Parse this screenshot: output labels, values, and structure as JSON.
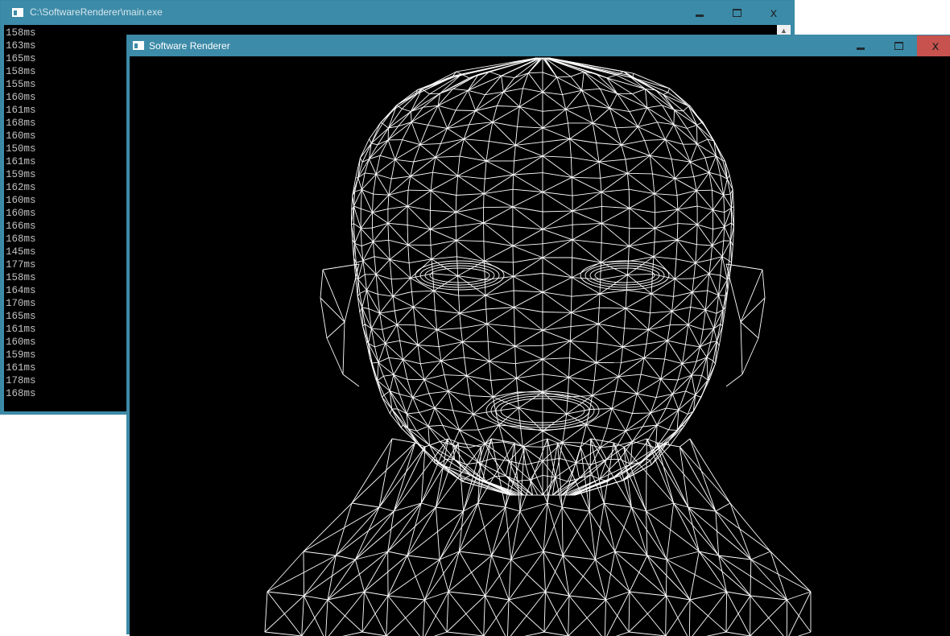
{
  "console": {
    "title": "C:\\SoftwareRenderer\\main.exe",
    "lines": [
      "158ms",
      "163ms",
      "165ms",
      "158ms",
      "155ms",
      "160ms",
      "161ms",
      "168ms",
      "160ms",
      "150ms",
      "161ms",
      "159ms",
      "162ms",
      "160ms",
      "160ms",
      "166ms",
      "168ms",
      "145ms",
      "177ms",
      "158ms",
      "164ms",
      "170ms",
      "165ms",
      "161ms",
      "160ms",
      "159ms",
      "161ms",
      "178ms",
      "168ms"
    ],
    "controls": {
      "minimize": "",
      "maximize": "",
      "close": "x"
    }
  },
  "renderer": {
    "title": "Software Renderer",
    "controls": {
      "minimize": "",
      "maximize": "",
      "close": "x"
    },
    "scene": {
      "subject": "head-wireframe-mesh",
      "line_color": "#ffffff",
      "background_color": "#000000"
    }
  },
  "colors": {
    "titlebar": "#3c8ba8",
    "close_active": "#c7524e"
  }
}
